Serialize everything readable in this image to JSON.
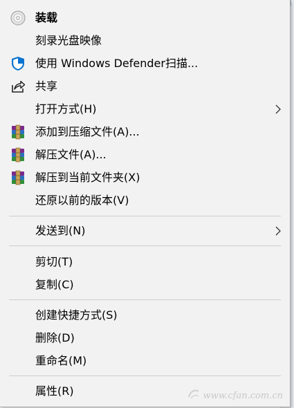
{
  "context_menu": {
    "items": [
      {
        "label": "装载",
        "icon": "disc-icon",
        "default": true
      },
      {
        "label": "刻录光盘映像"
      },
      {
        "label": "使用 Windows Defender扫描...",
        "icon": "shield-icon"
      },
      {
        "label": "共享",
        "icon": "share-icon"
      },
      {
        "label": "打开方式(H)",
        "submenu": true
      },
      {
        "label": "添加到压缩文件(A)...",
        "icon": "winrar-icon"
      },
      {
        "label": "解压文件(A)...",
        "icon": "winrar-icon"
      },
      {
        "label": "解压到当前文件夹(X)",
        "icon": "winrar-icon"
      },
      {
        "label": "还原以前的版本(V)"
      },
      {
        "label": "发送到(N)",
        "submenu": true
      },
      {
        "label": "剪切(T)"
      },
      {
        "label": "复制(C)"
      },
      {
        "label": "创建快捷方式(S)"
      },
      {
        "label": "删除(D)"
      },
      {
        "label": "重命名(M)"
      },
      {
        "label": "属性(R)"
      }
    ]
  },
  "watermark": {
    "text": "www.cfan.com.cn"
  },
  "colors": {
    "menu_background": "#f2f2f2",
    "separator": "#cccccc",
    "defender_blue": "#0a73d1",
    "winrar_purple": "#7b2a8c"
  }
}
